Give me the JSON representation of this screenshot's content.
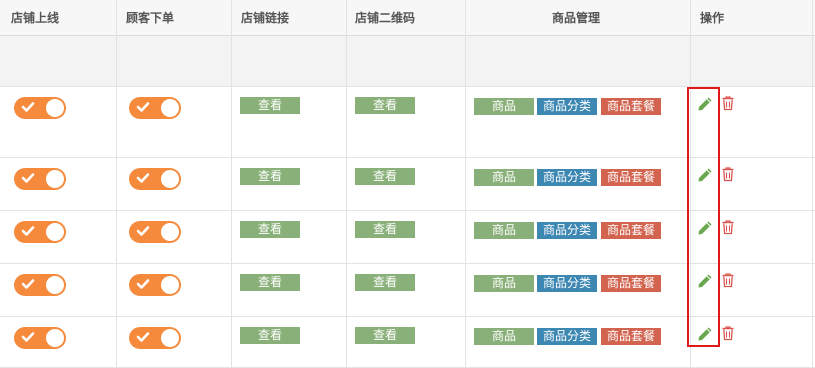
{
  "header": {
    "shop_online": "店铺上线",
    "customer_order": "顾客下单",
    "shop_link": "店铺链接",
    "shop_qrcode": "店铺二维码",
    "goods_manage": "商品管理",
    "actions": "操作"
  },
  "rows": [
    {
      "shop_online": {
        "on": true
      },
      "customer_order": {
        "on": true
      },
      "view_link": "查看",
      "view_qrcode": "查看",
      "goods": "商品",
      "goods_category": "商品分类",
      "goods_package": "商品套餐",
      "edit_icon": "pencil-icon",
      "delete_icon": "trash-icon"
    },
    {
      "shop_online": {
        "on": true
      },
      "customer_order": {
        "on": true
      },
      "view_link": "查看",
      "view_qrcode": "查看",
      "goods": "商品",
      "goods_category": "商品分类",
      "goods_package": "商品套餐",
      "edit_icon": "pencil-icon",
      "delete_icon": "trash-icon"
    },
    {
      "shop_online": {
        "on": true
      },
      "customer_order": {
        "on": true
      },
      "view_link": "查看",
      "view_qrcode": "查看",
      "goods": "商品",
      "goods_category": "商品分类",
      "goods_package": "商品套餐",
      "edit_icon": "pencil-icon",
      "delete_icon": "trash-icon"
    },
    {
      "shop_online": {
        "on": true
      },
      "customer_order": {
        "on": true
      },
      "view_link": "查看",
      "view_qrcode": "查看",
      "goods": "商品",
      "goods_category": "商品分类",
      "goods_package": "商品套餐",
      "edit_icon": "pencil-icon",
      "delete_icon": "trash-icon"
    },
    {
      "shop_online": {
        "on": true
      },
      "customer_order": {
        "on": true
      },
      "view_link": "查看",
      "view_qrcode": "查看",
      "goods": "商品",
      "goods_category": "商品分类",
      "goods_package": "商品套餐",
      "edit_icon": "pencil-icon",
      "delete_icon": "trash-icon"
    }
  ],
  "colors": {
    "toggle_on": "#f58a3c",
    "goods_button": "#8ab07a",
    "category_button": "#3d87b3",
    "package_button": "#d2634f",
    "edit_icon": "#6aa84f",
    "delete_icon": "#d9534f",
    "highlight_box": "#e01818"
  }
}
